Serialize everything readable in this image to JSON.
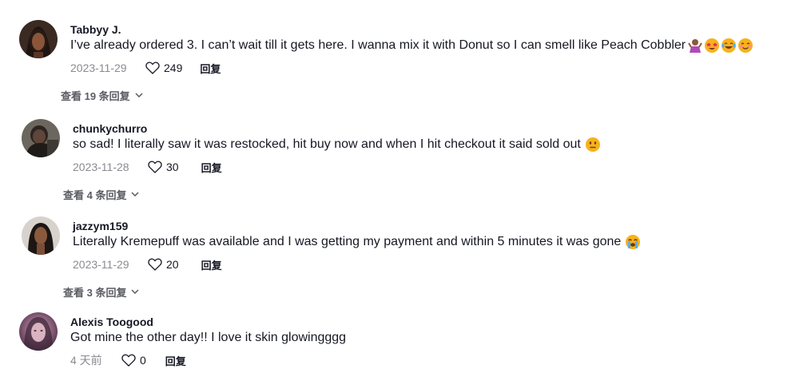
{
  "comments": [
    {
      "username": "Tabbyy J.",
      "text": "I’ve already ordered 3. I can’t wait till it gets here. I wanna mix it with Donut so I can smell like Peach Cobbler",
      "emojis": [
        "person-gesturing-icon",
        "star-struck-icon",
        "tears-of-joy-icon",
        "smiling-face-icon"
      ],
      "date": "2023-11-29",
      "likes": "249",
      "reply_label": "回复",
      "view_replies": "查看 19 条回复"
    },
    {
      "username": "chunkychurro",
      "text": "so sad! I literally saw it was restocked, hit buy now and when I hit checkout it said sold out",
      "emojis": [
        "neutral-face-icon"
      ],
      "date": "2023-11-28",
      "likes": "30",
      "reply_label": "回复",
      "view_replies": "查看 4 条回复"
    },
    {
      "username": "jazzym159",
      "text": "Literally Kremepuff was available and I was getting my payment and within 5 minutes it was gone",
      "emojis": [
        "loudly-crying-face-icon"
      ],
      "date": "2023-11-29",
      "likes": "20",
      "reply_label": "回复",
      "view_replies": "查看 3 条回复"
    },
    {
      "username": "Alexis Toogood",
      "text": "Got mine the other day!! I love it skin glowingggg",
      "emojis": [],
      "date": "4 天前",
      "likes": "0",
      "reply_label": "回复"
    }
  ]
}
